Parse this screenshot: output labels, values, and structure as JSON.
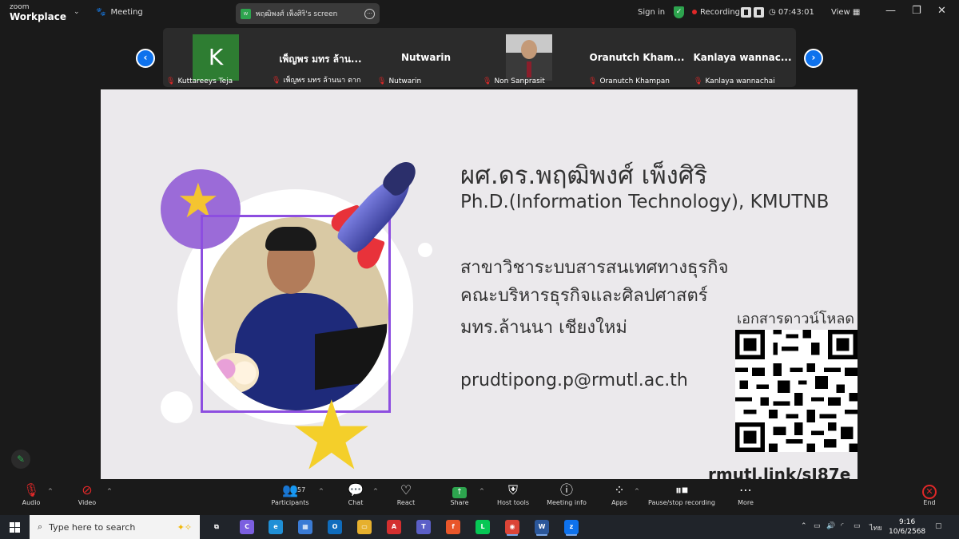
{
  "titlebar": {
    "brand_top": "zoom",
    "brand_bottom": "Workplace",
    "meeting": "Meeting",
    "shared_screen": "พฤฒิพงศ์ เพ็งศิริ's screen",
    "sign_in": "Sign in",
    "recording": "Recording...",
    "timer": "07:43:01",
    "view": "View"
  },
  "participants": [
    {
      "name": "Kuttareeys Teja",
      "big": "",
      "avatar_letter": "K"
    },
    {
      "name": "เพ็ญพร มทร ล้านนา ตาก",
      "big": "เพ็ญพร มทร ล้าน..."
    },
    {
      "name": "Nutwarin",
      "big": "Nutwarin"
    },
    {
      "name": "Non Sanprasit",
      "big": ""
    },
    {
      "name": "Oranutch Khampan",
      "big": "Oranutch Kham..."
    },
    {
      "name": "Kanlaya wannachai",
      "big": "Kanlaya wannac..."
    }
  ],
  "slide": {
    "name": "ผศ.ดร.พฤฒิพงศ์ เพ็งศิริ",
    "degree": "Ph.D.(Information Technology), KMUTNB",
    "line1": "สาขาวิชาระบบสารสนเทศทางธุรกิจ",
    "line2": "คณะบริหารธุรกิจและศิลปศาสตร์",
    "line3": "มทร.ล้านนา เชียงใหม่",
    "email": "prudtipong.p@rmutl.ac.th",
    "download_label": "เอกสารดาวน์โหลด",
    "link": "rmutl.link/sJ87e"
  },
  "toolbar": {
    "audio": "Audio",
    "video": "Video",
    "participants": "Participants",
    "participants_count": "57",
    "chat": "Chat",
    "react": "React",
    "share": "Share",
    "host_tools": "Host tools",
    "meeting_info": "Meeting info",
    "apps": "Apps",
    "pause_recording": "Pause/stop recording",
    "more": "More",
    "end": "End"
  },
  "taskbar": {
    "search_placeholder": "Type here to search",
    "time": "9:16",
    "date": "10/6/2568",
    "lang": "ไทย"
  },
  "colors": {
    "accent_blue": "#0e72ed",
    "purple": "#8d4ee0",
    "muted_red": "#e02828",
    "green": "#2da44e"
  }
}
